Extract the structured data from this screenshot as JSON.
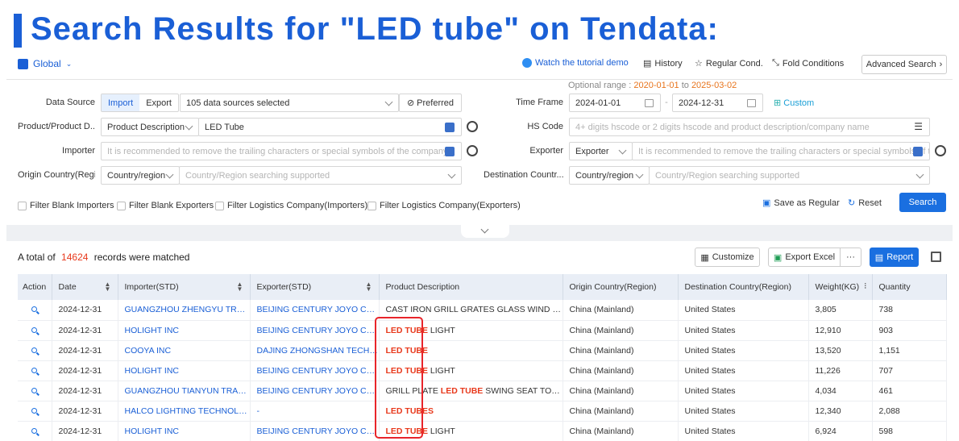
{
  "banner": {
    "title": "Search Results for \"LED tube\" on Tendata:"
  },
  "toolbar": {
    "scope": "Global",
    "tutorial": "Watch the tutorial demo",
    "history": "History",
    "regular_cond": "Regular Cond.",
    "fold": "Fold Conditions",
    "advanced": "Advanced Search"
  },
  "optional": {
    "label": "Optional range :",
    "start": "2020-01-01",
    "to": "to",
    "end": "2025-03-02"
  },
  "form": {
    "data_source_label": "Data Source",
    "import": "Import",
    "export": "Export",
    "sources": "105 data sources selected",
    "preferred": "Preferred",
    "time_frame_label": "Time Frame",
    "date_from": "2024-01-01",
    "date_sep": "-",
    "date_to": "2024-12-31",
    "custom": "Custom",
    "product_label": "Product/Product D...",
    "product_type": "Product Description",
    "product_value": "LED Tube",
    "hs_label": "HS Code",
    "hs_placeholder": "4+ digits hscode or 2 digits hscode and product description/company name",
    "importer_label": "Importer",
    "importer_placeholder": "It is recommended to remove the trailing characters or special symbols of the company",
    "exporter_label": "Exporter",
    "exporter_type": "Exporter",
    "exporter_placeholder": "It is recommended to remove the trailing characters or special symbols of th",
    "origin_label": "Origin Country(Regi...",
    "origin_type": "Country/region",
    "origin_placeholder": "Country/Region searching supported",
    "dest_label": "Destination Countr...",
    "dest_type": "Country/region",
    "dest_placeholder": "Country/Region searching supported"
  },
  "filters": [
    "Filter Blank Importers",
    "Filter Blank Exporters",
    "Filter Logistics Company(Importers)",
    "Filter Logistics Company(Exporters)"
  ],
  "actions": {
    "save_regular": "Save as Regular",
    "reset": "Reset",
    "search": "Search"
  },
  "results": {
    "prefix": "A total of",
    "count": "14624",
    "suffix": "records were matched"
  },
  "result_tools": {
    "customize": "Customize",
    "export_excel": "Export Excel",
    "more": "···",
    "report": "Report"
  },
  "table": {
    "headers": [
      "Action",
      "Date",
      "Importer(STD)",
      "Exporter(STD)",
      "Product Description",
      "Origin Country(Region)",
      "Destination Country(Region)",
      "Weight(KG)",
      "Quantity"
    ],
    "rows": [
      {
        "date": "2024-12-31",
        "importer": "GUANGZHOU ZHENGYU TRADI...",
        "exporter": "BEIJING CENTURY JOYO COU...",
        "desc_pre": "CAST IRON GRILL GRATES GLASS WIND GUA...",
        "desc_hl": "",
        "desc_post": "",
        "origin": "China (Mainland)",
        "dest": "United States",
        "weight": "3,805",
        "qty": "738"
      },
      {
        "date": "2024-12-31",
        "importer": "HOLIGHT INC",
        "exporter": "BEIJING CENTURY JOYO COU...",
        "desc_pre": "",
        "desc_hl": "LED TUBE",
        "desc_post": " LIGHT",
        "origin": "China (Mainland)",
        "dest": "United States",
        "weight": "12,910",
        "qty": "903"
      },
      {
        "date": "2024-12-31",
        "importer": "COOYA INC",
        "exporter": "DAJING ZHONGSHAN TECHN...",
        "desc_pre": "",
        "desc_hl": "LED TUBE",
        "desc_post": "",
        "origin": "China (Mainland)",
        "dest": "United States",
        "weight": "13,520",
        "qty": "1,151"
      },
      {
        "date": "2024-12-31",
        "importer": "HOLIGHT INC",
        "exporter": "BEIJING CENTURY JOYO COU...",
        "desc_pre": "",
        "desc_hl": "LED TUBE",
        "desc_post": " LIGHT",
        "origin": "China (Mainland)",
        "dest": "United States",
        "weight": "11,226",
        "qty": "707"
      },
      {
        "date": "2024-12-31",
        "importer": "GUANGZHOU TIANYUN TRADI...",
        "exporter": "BEIJING CENTURY JOYO COU...",
        "desc_pre": "GRILL PLATE ",
        "desc_hl": "LED TUBE",
        "desc_post": " SWING SEAT TOWEL ...",
        "origin": "China (Mainland)",
        "dest": "United States",
        "weight": "4,034",
        "qty": "461"
      },
      {
        "date": "2024-12-31",
        "importer": "HALCO LIGHTING TECHNOLOG...",
        "exporter": "-",
        "desc_pre": "",
        "desc_hl": "LED TUBES",
        "desc_post": "",
        "origin": "China (Mainland)",
        "dest": "United States",
        "weight": "12,340",
        "qty": "2,088"
      },
      {
        "date": "2024-12-31",
        "importer": "HOLIGHT INC",
        "exporter": "BEIJING CENTURY JOYO COU...",
        "desc_pre": "",
        "desc_hl": "LED TUBE",
        "desc_post": " LIGHT",
        "origin": "China (Mainland)",
        "dest": "United States",
        "weight": "6,924",
        "qty": "598"
      }
    ]
  }
}
